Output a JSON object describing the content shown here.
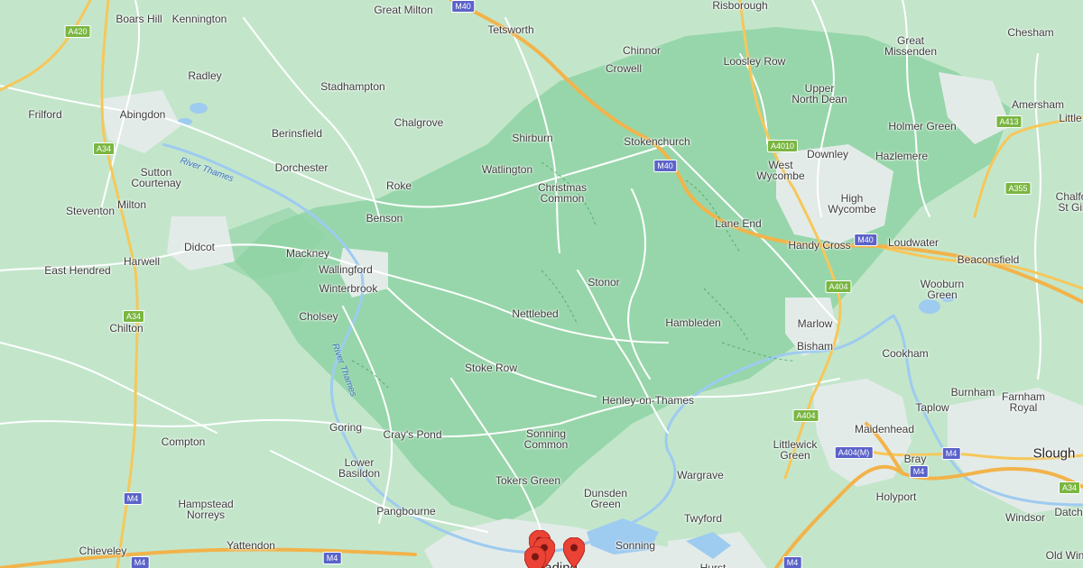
{
  "map": {
    "colors": {
      "land": "#c3e6cb",
      "forest": "#8fd2a4",
      "urban": "#e6ecec",
      "water": "#9ecbf0",
      "road": "#ffffff",
      "major_road": "#f6c75a",
      "motorway": "#f2b34a",
      "pin": "#ea4335"
    },
    "places": [
      {
        "name": "Boars Hill"
      },
      {
        "name": "Kennington"
      },
      {
        "name": "Great Milton"
      },
      {
        "name": "Risborough"
      },
      {
        "name": "Tetsworth"
      },
      {
        "name": "Chinnor"
      },
      {
        "name": "Crowell"
      },
      {
        "name": "Loosley Row"
      },
      {
        "name": "Great\nMissenden"
      },
      {
        "name": "Chesham"
      },
      {
        "name": "Radley"
      },
      {
        "name": "Stadhampton"
      },
      {
        "name": "Upper\nNorth Dean"
      },
      {
        "name": "Amersham"
      },
      {
        "name": "Frilford"
      },
      {
        "name": "Abingdon"
      },
      {
        "name": "Chalgrove"
      },
      {
        "name": "Little"
      },
      {
        "name": "Holmer Green"
      },
      {
        "name": "Berinsfield"
      },
      {
        "name": "Shirburn"
      },
      {
        "name": "Stokenchurch"
      },
      {
        "name": "Downley"
      },
      {
        "name": "Hazlemere"
      },
      {
        "name": "Dorchester"
      },
      {
        "name": "Watlington"
      },
      {
        "name": "West\nWycombe"
      },
      {
        "name": "Sutton\nCourtenay"
      },
      {
        "name": "Roke"
      },
      {
        "name": "Christmas\nCommon"
      },
      {
        "name": "High\nWycombe"
      },
      {
        "name": "Chalfo\nSt Gil"
      },
      {
        "name": "Milton"
      },
      {
        "name": "Steventon"
      },
      {
        "name": "Benson"
      },
      {
        "name": "Lane End"
      },
      {
        "name": "Didcot"
      },
      {
        "name": "Handy Cross"
      },
      {
        "name": "Loudwater"
      },
      {
        "name": "Mackney"
      },
      {
        "name": "Harwell"
      },
      {
        "name": "Beaconsfield"
      },
      {
        "name": "East Hendred"
      },
      {
        "name": "Wallingford"
      },
      {
        "name": "Stonor"
      },
      {
        "name": "Wooburn\nGreen"
      },
      {
        "name": "Winterbrook"
      },
      {
        "name": "Nettlebed"
      },
      {
        "name": "Cholsey"
      },
      {
        "name": "Hambleden"
      },
      {
        "name": "Marlow"
      },
      {
        "name": "Chilton"
      },
      {
        "name": "Bisham"
      },
      {
        "name": "Cookham"
      },
      {
        "name": "Stoke Row"
      },
      {
        "name": "Burnham"
      },
      {
        "name": "Farnham\nRoyal"
      },
      {
        "name": "Henley-on-Thames"
      },
      {
        "name": "Taplow"
      },
      {
        "name": "Goring"
      },
      {
        "name": "Cray's Pond"
      },
      {
        "name": "Maidenhead"
      },
      {
        "name": "Compton"
      },
      {
        "name": "Sonning\nCommon"
      },
      {
        "name": "Littlewick\nGreen"
      },
      {
        "name": "Slough"
      },
      {
        "name": "Lower\nBasildon"
      },
      {
        "name": "Bray"
      },
      {
        "name": "Wargrave"
      },
      {
        "name": "Tokers Green"
      },
      {
        "name": "Holyport"
      },
      {
        "name": "Dunsden\nGreen"
      },
      {
        "name": "Hampstead\nNorreys"
      },
      {
        "name": "Pangbourne"
      },
      {
        "name": "Twyford"
      },
      {
        "name": "Windsor"
      },
      {
        "name": "Datch"
      },
      {
        "name": "Yattendon"
      },
      {
        "name": "Sonning"
      },
      {
        "name": "Chieveley"
      },
      {
        "name": "Old Win"
      },
      {
        "name": "Hurst"
      },
      {
        "name": "Reading"
      }
    ],
    "rivers": [
      {
        "label": "River Thames"
      },
      {
        "label": "River Thames"
      }
    ],
    "road_shields": [
      {
        "label": "M40",
        "kind": "motorway"
      },
      {
        "label": "A420",
        "kind": "primary"
      },
      {
        "label": "A34",
        "kind": "primary"
      },
      {
        "label": "A413",
        "kind": "primary"
      },
      {
        "label": "A4010",
        "kind": "primary"
      },
      {
        "label": "M40",
        "kind": "motorway"
      },
      {
        "label": "A355",
        "kind": "primary"
      },
      {
        "label": "M40",
        "kind": "motorway"
      },
      {
        "label": "A404",
        "kind": "primary"
      },
      {
        "label": "A34",
        "kind": "primary"
      },
      {
        "label": "A404",
        "kind": "primary"
      },
      {
        "label": "A404(M)",
        "kind": "motorway"
      },
      {
        "label": "M4",
        "kind": "motorway"
      },
      {
        "label": "M4",
        "kind": "motorway"
      },
      {
        "label": "M4",
        "kind": "motorway"
      },
      {
        "label": "A34",
        "kind": "primary"
      },
      {
        "label": "M4",
        "kind": "motorway"
      },
      {
        "label": "M4",
        "kind": "motorway"
      },
      {
        "label": "M4",
        "kind": "motorway"
      }
    ],
    "pins": [
      {
        "name": "location-pin"
      },
      {
        "name": "location-pin"
      },
      {
        "name": "location-pin"
      },
      {
        "name": "location-pin"
      }
    ]
  }
}
